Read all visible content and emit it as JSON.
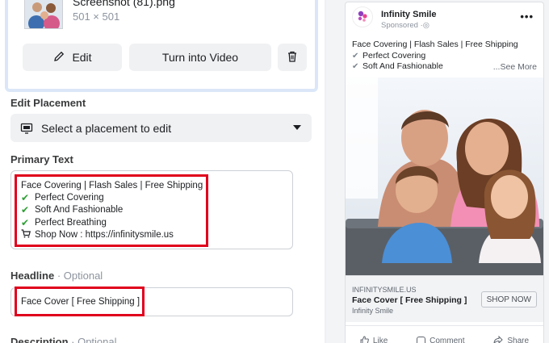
{
  "media": {
    "file_name": "Screenshot (81).png",
    "dimensions": "501 × 501",
    "edit_label": "Edit",
    "video_label": "Turn into Video"
  },
  "placement": {
    "section_label": "Edit Placement",
    "select_text": "Select a placement to edit"
  },
  "primary": {
    "section_label": "Primary Text",
    "lines": [
      {
        "icon": "check",
        "text": "Face Covering | Flash Sales | Free Shipping"
      },
      {
        "icon": "check",
        "text": "Perfect Covering"
      },
      {
        "icon": "check",
        "text": "Soft And Fashionable"
      },
      {
        "icon": "check",
        "text": "Perfect Breathing"
      },
      {
        "icon": "cart",
        "text": "Shop Now :  https://infinitysmile.us"
      }
    ]
  },
  "headline": {
    "section_label": "Headline",
    "optional_label": "Optional",
    "value": "Face Cover [ Free Shipping ]"
  },
  "description": {
    "section_label": "Description",
    "optional_label": "Optional"
  },
  "preview": {
    "page_name": "Infinity Smile",
    "sponsored": "Sponsored",
    "more_glyph": "•••",
    "text_line1": "Face Covering | Flash Sales | Free Shipping",
    "text_line2": "Perfect Covering",
    "text_line3": "Soft And Fashionable",
    "see_more": "...See More",
    "domain": "INFINITYSMILE.US",
    "link_title": "Face Cover [ Free Shipping ]",
    "link_sub": "Infinity Smile",
    "cta": "SHOP NOW",
    "like": "Like",
    "comment": "Comment",
    "share": "Share"
  },
  "colors": {
    "highlight_red": "#e0001b",
    "check_green": "#2e9e34",
    "selection_blue": "#dbe7f8"
  }
}
